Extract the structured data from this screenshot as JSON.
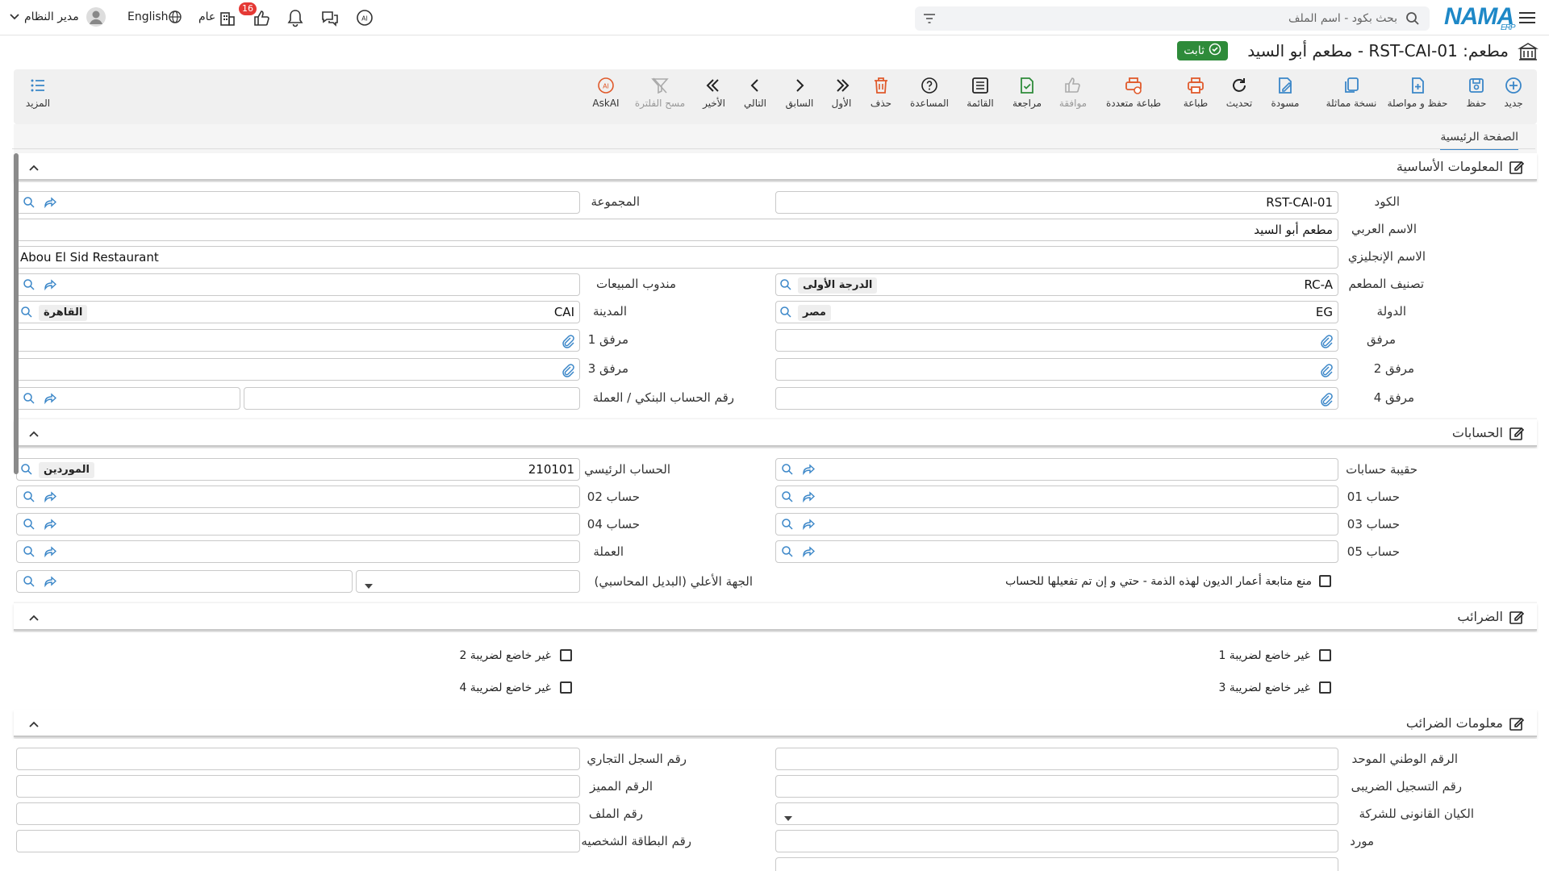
{
  "topbar": {
    "logo_text": "NAMA",
    "logo_sub": "ERP",
    "search_placeholder": "بحث بكود - اسم الملف",
    "user_name": "مدير النظام",
    "language": "English",
    "scope": "عام",
    "notification_count": "16"
  },
  "page": {
    "title": "مطعم: RST-CAI-01 - مطعم أبو السيد",
    "status": "ثابت"
  },
  "toolbar": {
    "new": "جديد",
    "save": "حفظ",
    "save_continue": "حفظ و مواصلة",
    "duplicate": "نسخة مماثلة",
    "draft": "مسودة",
    "refresh": "تحديث",
    "print": "طباعة",
    "multi_print": "طباعة متعددة",
    "approve": "موافقة",
    "review": "مراجعة",
    "list": "القائمة",
    "help": "المساعدة",
    "delete": "حذف",
    "first": "الأول",
    "previous": "السابق",
    "next": "التالي",
    "last": "الأخير",
    "clear_filter": "مسح الفلترة",
    "askai": "AskAI",
    "more": "المزيد"
  },
  "tab": {
    "main": "الصفحة الرئيسية"
  },
  "sections": {
    "basic": "المعلومات الأساسية",
    "accounts": "الحسابات",
    "taxes": "الضرائب",
    "tax_info": "معلومات الضرائب"
  },
  "basic": {
    "code_label": "الكود",
    "code_value": "RST-CAI-01",
    "group_label": "المجموعة",
    "arabic_name_label": "الاسم العربي",
    "arabic_name_value": "مطعم أبو السيد",
    "english_name_label": "الاسم الإنجليزي",
    "english_name_value": "Abou El Sid Restaurant",
    "classification_label": "تصنيف المطعم",
    "classification_code": "RC-A",
    "classification_name": "الدرجة الأولى",
    "sales_rep_label": "مندوب المبيعات",
    "country_label": "الدولة",
    "country_code": "EG",
    "country_name": "مصر",
    "city_label": "المدينة",
    "city_code": "CAI",
    "city_name": "القاهرة",
    "attachment_label": "مرفق",
    "attachment1_label": "مرفق 1",
    "attachment2_label": "مرفق 2",
    "attachment3_label": "مرفق 3",
    "attachment4_label": "مرفق 4",
    "bank_account_label": "رقم الحساب البنكي / العملة"
  },
  "accounts": {
    "portfolio_label": "حقيبة حسابات",
    "main_account_label": "الحساب الرئيسي",
    "main_account_code": "210101",
    "main_account_name": "الموردين",
    "acc01_label": "حساب 01",
    "acc02_label": "حساب 02",
    "acc03_label": "حساب 03",
    "acc04_label": "حساب 04",
    "acc05_label": "حساب 05",
    "currency_label": "العملة",
    "prevent_aging_label": "منع متابعة أعمار الديون لهذه الذمة - حتي و إن تم تفعيلها للحساب",
    "parent_entity_label": "الجهة الأعلي (البديل المحاسبي)"
  },
  "taxes": {
    "tax1": "غير خاضع لضريبة 1",
    "tax2": "غير خاضع لضريبة 2",
    "tax3": "غير خاضع لضريبة 3",
    "tax4": "غير خاضع لضريبة 4"
  },
  "tax_info": {
    "national_id_label": "الرقم الوطني الموحد",
    "commercial_reg_label": "رقم السجل التجاري",
    "tax_reg_label": "رقم التسجيل الضريبى",
    "distinguished_no_label": "الرقم المميز",
    "legal_entity_label": "الكيان القانونى للشركة",
    "file_no_label": "رقم الملف",
    "supplier_label": "مورد",
    "id_card_label": "رقم البطاقة الشخصيه"
  },
  "colors": {
    "brand": "#1e88c7",
    "status_green": "#2e8b3a",
    "icon_blue": "#3a86c8",
    "icon_red": "#e05a2b",
    "badge_red": "#e53935"
  }
}
